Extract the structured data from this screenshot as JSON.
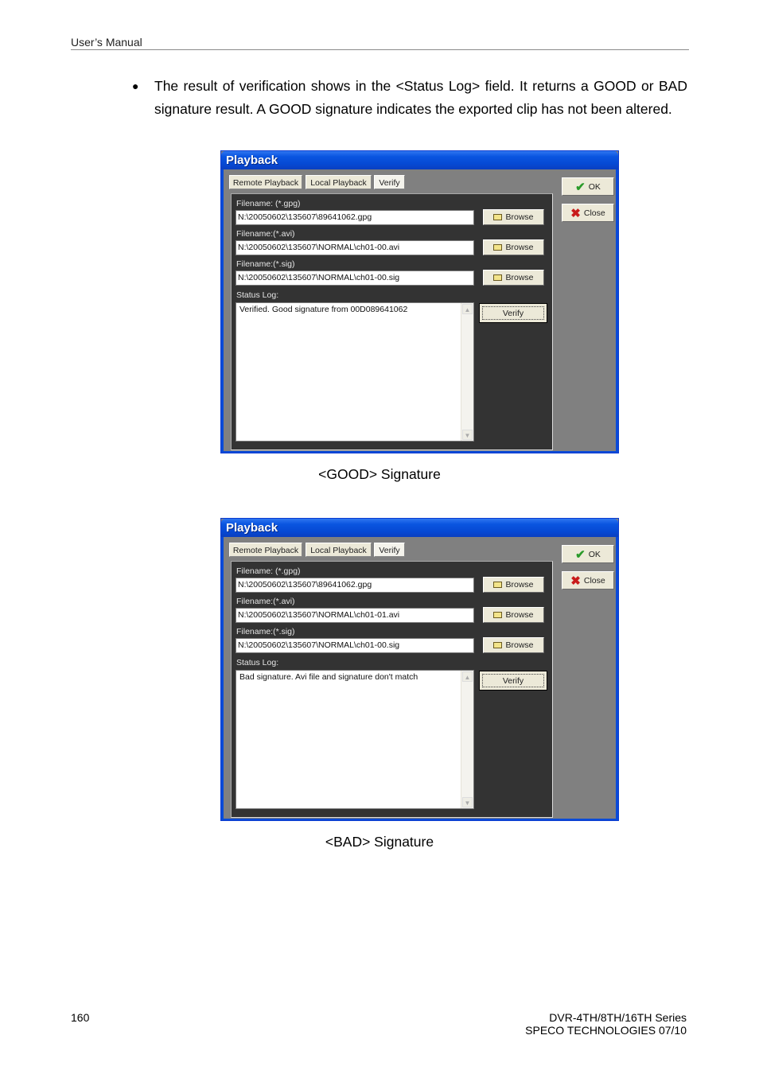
{
  "page": {
    "header": "User’s Manual",
    "bullet_text": "The result of verification shows in the <Status Log> field. It returns a GOOD or BAD signature result. A GOOD signature indicates the exported clip has not been altered.",
    "page_number": "160",
    "footer_line1": "DVR-4TH/8TH/16TH Series",
    "footer_line2": "SPECO TECHNOLOGIES 07/10"
  },
  "dialogs": [
    {
      "caption": "<GOOD> Signature",
      "title": "Playback",
      "tabs": [
        "Remote Playback",
        "Local Playback",
        "Verify"
      ],
      "active_tab": "Verify",
      "fields": [
        {
          "label": "Filename: (*.gpg)",
          "value": "N:\\20050602\\135607\\89641062.gpg"
        },
        {
          "label": "Filename:(*.avi)",
          "value": "N:\\20050602\\135607\\NORMAL\\ch01-00.avi"
        },
        {
          "label": "Filename:(*.sig)",
          "value": "N:\\20050602\\135607\\NORMAL\\ch01-00.sig"
        }
      ],
      "browse_label": "Browse",
      "status_log_label": "Status Log:",
      "status_log_text": "Verified. Good signature from 00D089641062",
      "verify_label": "Verify",
      "ok_label": "OK",
      "close_label": "Close"
    },
    {
      "caption": "<BAD> Signature",
      "title": "Playback",
      "tabs": [
        "Remote Playback",
        "Local Playback",
        "Verify"
      ],
      "active_tab": "Verify",
      "fields": [
        {
          "label": "Filename: (*.gpg)",
          "value": "N:\\20050602\\135607\\89641062.gpg"
        },
        {
          "label": "Filename:(*.avi)",
          "value": "N:\\20050602\\135607\\NORMAL\\ch01-01.avi"
        },
        {
          "label": "Filename:(*.sig)",
          "value": "N:\\20050602\\135607\\NORMAL\\ch01-00.sig"
        }
      ],
      "browse_label": "Browse",
      "status_log_label": "Status Log:",
      "status_log_text": "Bad signature. Avi file and signature don't match",
      "verify_label": "Verify",
      "ok_label": "OK",
      "close_label": "Close"
    }
  ]
}
